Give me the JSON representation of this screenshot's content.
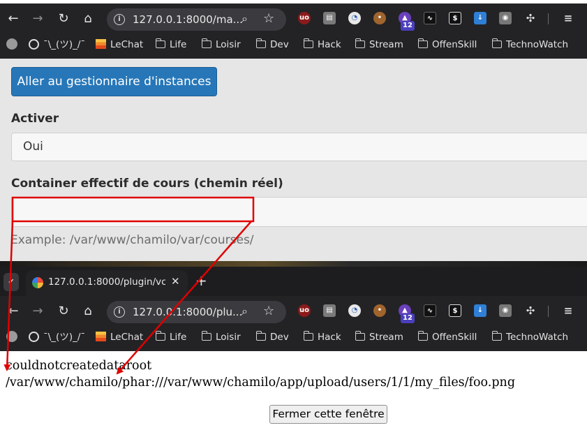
{
  "top_browser": {
    "url": "127.0.0.1:8000/ma..."
  },
  "bottom_browser": {
    "tab_title": "127.0.0.1:8000/plugin/vc",
    "url": "127.0.0.1:8000/plu...",
    "new_tab": "+"
  },
  "extensions": {
    "badge_count": "12"
  },
  "bookmarks": [
    "¯\\_(ツ)_/¯",
    "LeChat",
    "Life",
    "Loisir",
    "Dev",
    "Hack",
    "Stream",
    "OffenSkill",
    "TechnoWatch"
  ],
  "form": {
    "instances_button": "Aller au gestionnaire d'instances",
    "activate_label": "Activer",
    "activate_value": "Oui",
    "container_label": "Container effectif de cours (chemin réel)",
    "container_value": "",
    "container_example": "Example: /var/www/chamilo/var/courses/"
  },
  "result": {
    "error_line1": "couldnotcreatedataroot",
    "error_line2": "/var/www/chamilo/phar:///var/www/chamilo/app/upload/users/1/1/my_files/foo.png",
    "close_button": "Fermer cette fenêtre"
  },
  "colors": {
    "annotation": "#e00000",
    "primary_button": "#2777b8",
    "chrome": "#232326"
  },
  "icons": {
    "back": "arrow-left",
    "forward": "arrow-right",
    "reload": "refresh",
    "home": "home",
    "site_info": "info",
    "zoom": "magnifier",
    "bookmark_star": "star"
  }
}
